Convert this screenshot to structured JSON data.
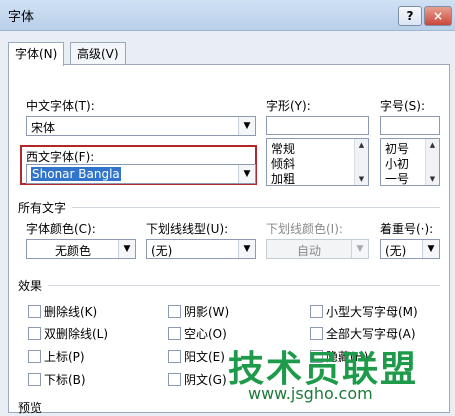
{
  "window": {
    "title": "字体",
    "help_label": "?",
    "close_label": "×"
  },
  "tabs": [
    {
      "label": "字体(N)"
    },
    {
      "label": "高级(V)"
    }
  ],
  "fonts": {
    "chinese_label": "中文字体(T):",
    "chinese_value": "宋体",
    "western_label": "西文字体(F):",
    "western_value": "Shonar Bangla",
    "style_label": "字形(Y):",
    "style_options": [
      "常规",
      "倾斜",
      "加粗"
    ],
    "size_label": "字号(S):",
    "size_options": [
      "初号",
      "小初",
      "一号"
    ]
  },
  "all_text": {
    "heading": "所有文字",
    "color_label": "字体颜色(C):",
    "color_value": "无颜色",
    "underline_label": "下划线线型(U):",
    "underline_value": "(无)",
    "underline_color_label": "下划线颜色(I):",
    "underline_color_value": "自动",
    "emphasis_label": "着重号(·):",
    "emphasis_value": "(无)"
  },
  "effects": {
    "heading": "效果",
    "col1": [
      "删除线(K)",
      "双删除线(L)",
      "上标(P)",
      "下标(B)"
    ],
    "col2": [
      "阴影(W)",
      "空心(O)",
      "阳文(E)",
      "阴文(G)"
    ],
    "col3": [
      "小型大写字母(M)",
      "全部大写字母(A)",
      "隐藏(H)"
    ]
  },
  "preview_label": "预览",
  "watermark": {
    "text": "技术员联盟",
    "url": "www.jsgho.com"
  },
  "colors": {
    "accent_selection": "#3074cc",
    "highlight_border": "#b0282a",
    "watermark_green": "#1e9b4a"
  }
}
